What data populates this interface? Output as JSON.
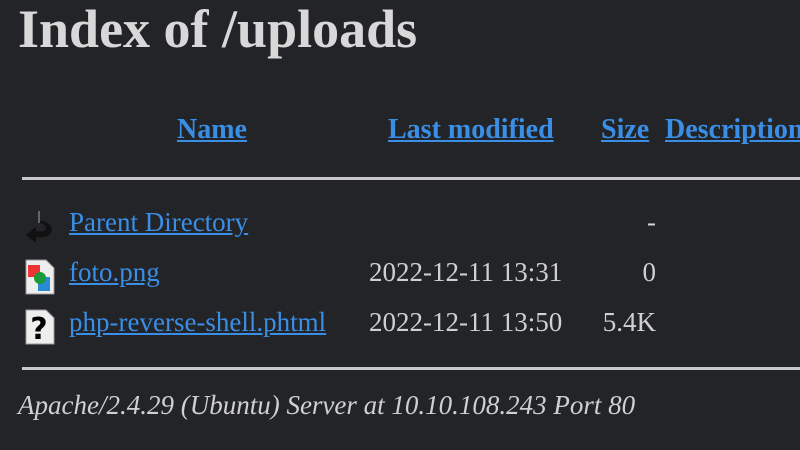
{
  "title": "Index of /uploads",
  "columns": {
    "name": "Name",
    "last_modified": "Last modified",
    "size": "Size",
    "description": "Description"
  },
  "rows": [
    {
      "icon": "back-icon",
      "name": "Parent Directory",
      "modified": "",
      "size": "-"
    },
    {
      "icon": "image-file-icon",
      "name": "foto.png",
      "modified": "2022-12-11 13:31",
      "size": "0"
    },
    {
      "icon": "unknown-file-icon",
      "name": "php-reverse-shell.phtml",
      "modified": "2022-12-11 13:50",
      "size": "5.4K"
    }
  ],
  "footer": "Apache/2.4.29 (Ubuntu) Server at 10.10.108.243 Port 80"
}
